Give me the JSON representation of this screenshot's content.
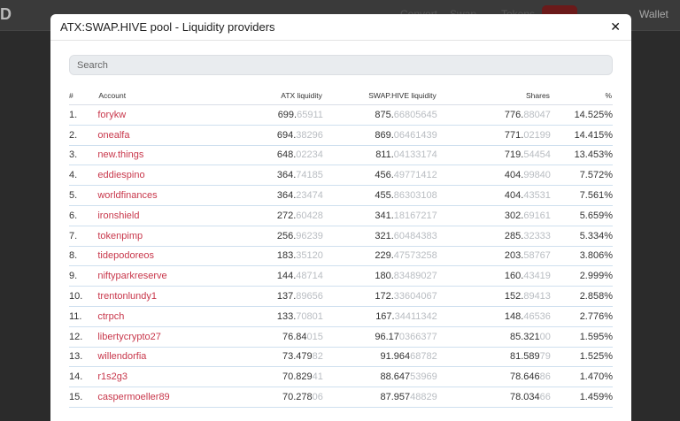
{
  "background": {
    "logo": "D",
    "nav": [
      "Convert",
      "Swap",
      "Tokens"
    ],
    "wallet": "Wallet"
  },
  "modal": {
    "title": "ATX:SWAP.HIVE pool - Liquidity providers",
    "close_label": "✕",
    "search_placeholder": "Search"
  },
  "table": {
    "headers": {
      "num": "#",
      "account": "Account",
      "atx": "ATX liquidity",
      "hive": "SWAP.HIVE liquidity",
      "shares": "Shares",
      "pct": "%"
    },
    "rows": [
      {
        "num": "1.",
        "account": "forykw",
        "atx_main": "699.",
        "atx_dim": "65911",
        "hive_main": "875.",
        "hive_dim": "66805645",
        "sh_main": "776.",
        "sh_dim": "88047",
        "pct": "14.525%"
      },
      {
        "num": "2.",
        "account": "onealfa",
        "atx_main": "694.",
        "atx_dim": "38296",
        "hive_main": "869.",
        "hive_dim": "06461439",
        "sh_main": "771.",
        "sh_dim": "02199",
        "pct": "14.415%"
      },
      {
        "num": "3.",
        "account": "new.things",
        "atx_main": "648.",
        "atx_dim": "02234",
        "hive_main": "811.",
        "hive_dim": "04133174",
        "sh_main": "719.",
        "sh_dim": "54454",
        "pct": "13.453%"
      },
      {
        "num": "4.",
        "account": "eddiespino",
        "atx_main": "364.",
        "atx_dim": "74185",
        "hive_main": "456.",
        "hive_dim": "49771412",
        "sh_main": "404.",
        "sh_dim": "99840",
        "pct": "7.572%"
      },
      {
        "num": "5.",
        "account": "worldfinances",
        "atx_main": "364.",
        "atx_dim": "23474",
        "hive_main": "455.",
        "hive_dim": "86303108",
        "sh_main": "404.",
        "sh_dim": "43531",
        "pct": "7.561%"
      },
      {
        "num": "6.",
        "account": "ironshield",
        "atx_main": "272.",
        "atx_dim": "60428",
        "hive_main": "341.",
        "hive_dim": "18167217",
        "sh_main": "302.",
        "sh_dim": "69161",
        "pct": "5.659%"
      },
      {
        "num": "7.",
        "account": "tokenpimp",
        "atx_main": "256.",
        "atx_dim": "96239",
        "hive_main": "321.",
        "hive_dim": "60484383",
        "sh_main": "285.",
        "sh_dim": "32333",
        "pct": "5.334%"
      },
      {
        "num": "8.",
        "account": "tidepodoreos",
        "atx_main": "183.",
        "atx_dim": "35120",
        "hive_main": "229.",
        "hive_dim": "47573258",
        "sh_main": "203.",
        "sh_dim": "58767",
        "pct": "3.806%"
      },
      {
        "num": "9.",
        "account": "niftyparkreserve",
        "atx_main": "144.",
        "atx_dim": "48714",
        "hive_main": "180.",
        "hive_dim": "83489027",
        "sh_main": "160.",
        "sh_dim": "43419",
        "pct": "2.999%"
      },
      {
        "num": "10.",
        "account": "trentonlundy1",
        "atx_main": "137.",
        "atx_dim": "89656",
        "hive_main": "172.",
        "hive_dim": "33604067",
        "sh_main": "152.",
        "sh_dim": "89413",
        "pct": "2.858%"
      },
      {
        "num": "11.",
        "account": "ctrpch",
        "atx_main": "133.",
        "atx_dim": "70801",
        "hive_main": "167.",
        "hive_dim": "34411342",
        "sh_main": "148.",
        "sh_dim": "46536",
        "pct": "2.776%"
      },
      {
        "num": "12.",
        "account": "libertycrypto27",
        "atx_main": "76.84",
        "atx_dim": "015",
        "hive_main": "96.17",
        "hive_dim": "0366377",
        "sh_main": "85.321",
        "sh_dim": "00",
        "pct": "1.595%"
      },
      {
        "num": "13.",
        "account": "willendorfia",
        "atx_main": "73.479",
        "atx_dim": "82",
        "hive_main": "91.964",
        "hive_dim": "68782",
        "sh_main": "81.589",
        "sh_dim": "79",
        "pct": "1.525%"
      },
      {
        "num": "14.",
        "account": "r1s2g3",
        "atx_main": "70.829",
        "atx_dim": "41",
        "hive_main": "88.647",
        "hive_dim": "53969",
        "sh_main": "78.646",
        "sh_dim": "86",
        "pct": "1.470%"
      },
      {
        "num": "15.",
        "account": "caspermoeller89",
        "atx_main": "70.278",
        "atx_dim": "06",
        "hive_main": "87.957",
        "hive_dim": "48829",
        "sh_main": "78.034",
        "sh_dim": "66",
        "pct": "1.459%"
      }
    ]
  }
}
